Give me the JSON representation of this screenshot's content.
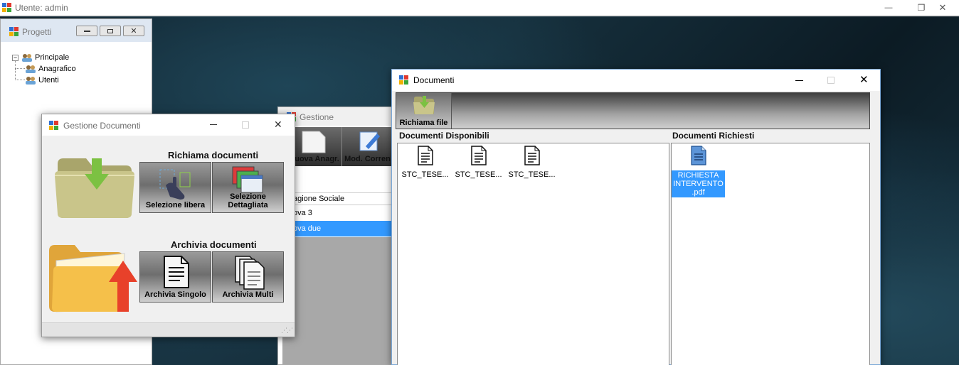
{
  "app": {
    "title": "Utente: admin",
    "controls": {
      "minimize": "—",
      "restore": "❐",
      "close": "✕"
    }
  },
  "progetti": {
    "title": "Progetti",
    "tree": [
      {
        "label": "Principale",
        "expander": "⊟"
      },
      {
        "label": "Anagrafico"
      },
      {
        "label": "Utenti"
      }
    ]
  },
  "gestione": {
    "title": "Gestione",
    "toolbar": [
      "uova Anagr.",
      "Mod. Corren"
    ],
    "grid_header": "agione Sociale",
    "rows": [
      "ova 3",
      "ova due"
    ]
  },
  "gestione_documenti": {
    "title": "Gestione Documenti",
    "richiama": {
      "title": "Richiama documenti",
      "buttons": [
        "Selezione libera",
        "Selezione Dettagliata"
      ]
    },
    "archivia": {
      "title": "Archivia documenti",
      "buttons": [
        "Archivia Singolo",
        "Archivia Multi"
      ]
    }
  },
  "documenti": {
    "title": "Documenti",
    "toolbar": {
      "richiama_file": "Richiama file"
    },
    "disponibili": {
      "title": "Documenti Disponibili",
      "files": [
        "STC_TESE...",
        "STC_TESE...",
        "STC_TESE..."
      ]
    },
    "richiesti": {
      "title": "Documenti Richiesti",
      "files": [
        "RICHIESTA INTERVENTO .pdf"
      ]
    }
  },
  "colors": {
    "selection": "#3399ff",
    "title_inactive": "#6d6d6d",
    "folder_green": "#8fd14f",
    "arrow_red": "#e8412a",
    "folder_yellow": "#f5c04a"
  }
}
